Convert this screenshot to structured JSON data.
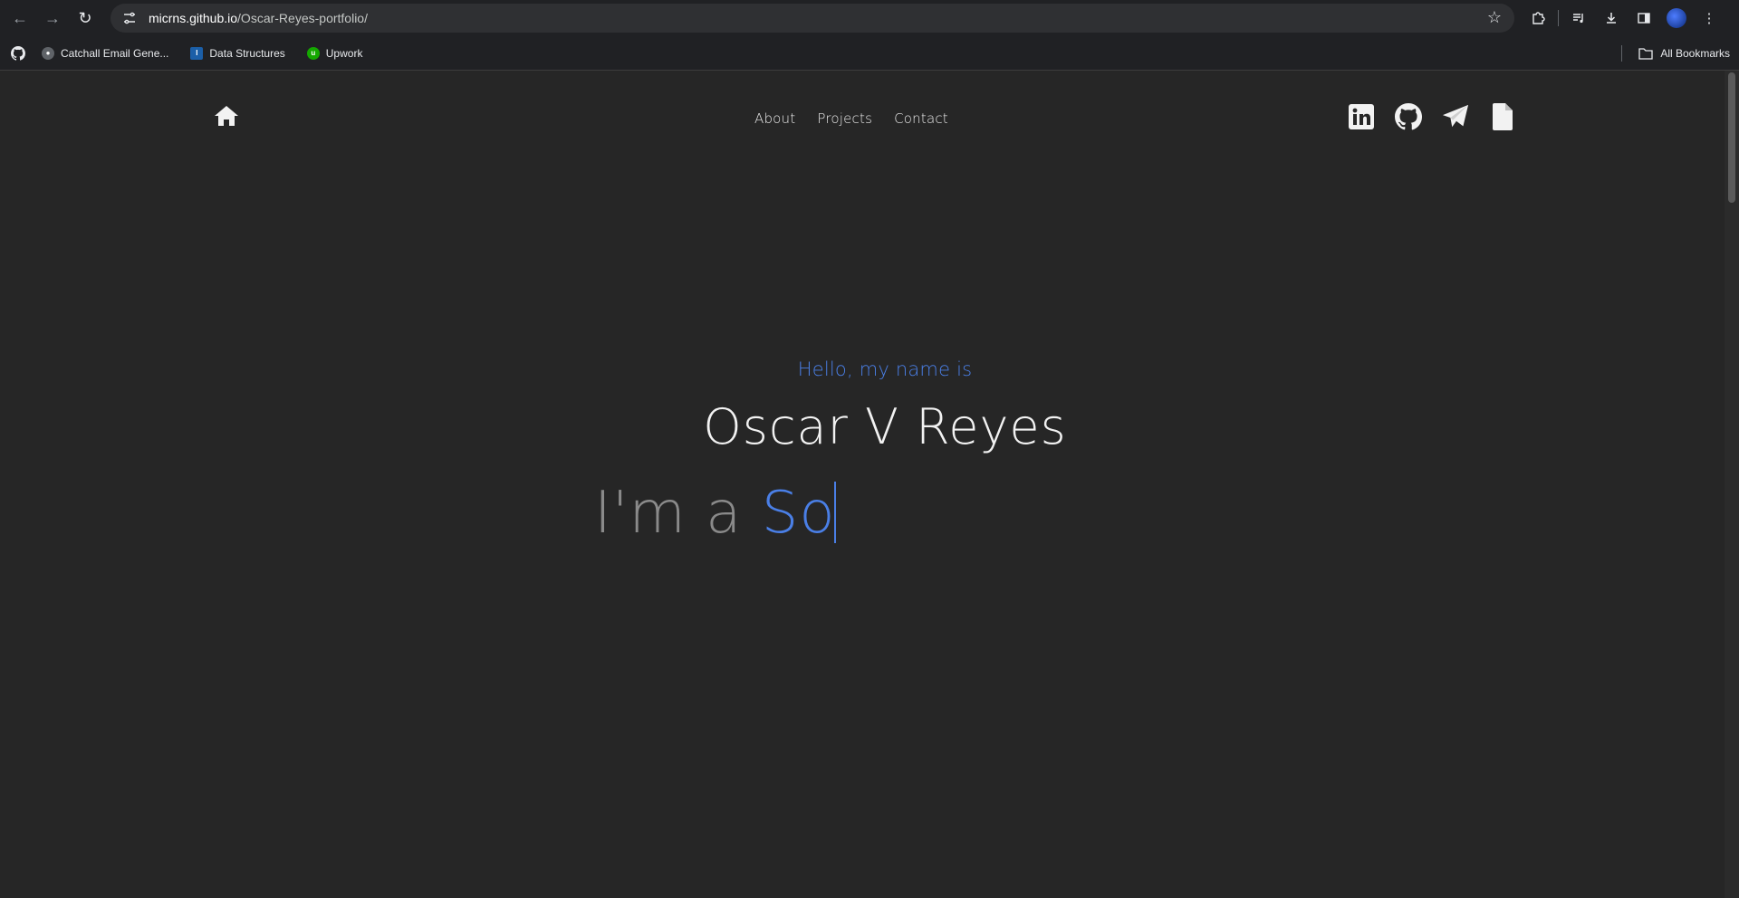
{
  "browser": {
    "url_host": "micrns.github.io",
    "url_path": "/Oscar-Reyes-portfolio/",
    "bookmarks": [
      {
        "label": "Catchall Email Gene...",
        "icon": "globe-icon"
      },
      {
        "label": "Data Structures",
        "icon": "uci-ics-icon"
      },
      {
        "label": "Upwork",
        "icon": "upwork-icon"
      }
    ],
    "all_bookmarks_label": "All Bookmarks"
  },
  "site": {
    "nav": [
      "About",
      "Projects",
      "Contact"
    ],
    "social_icons": [
      "linkedin-icon",
      "github-icon",
      "telegram-icon",
      "resume-file-icon"
    ],
    "hello": "Hello, my name is",
    "name": "Oscar V Reyes",
    "typed_prefix": "I'm a ",
    "typed_text": "So"
  },
  "colors": {
    "page_bg": "#262626",
    "accent": "#4a7fe6",
    "chrome_bg": "#202124"
  }
}
